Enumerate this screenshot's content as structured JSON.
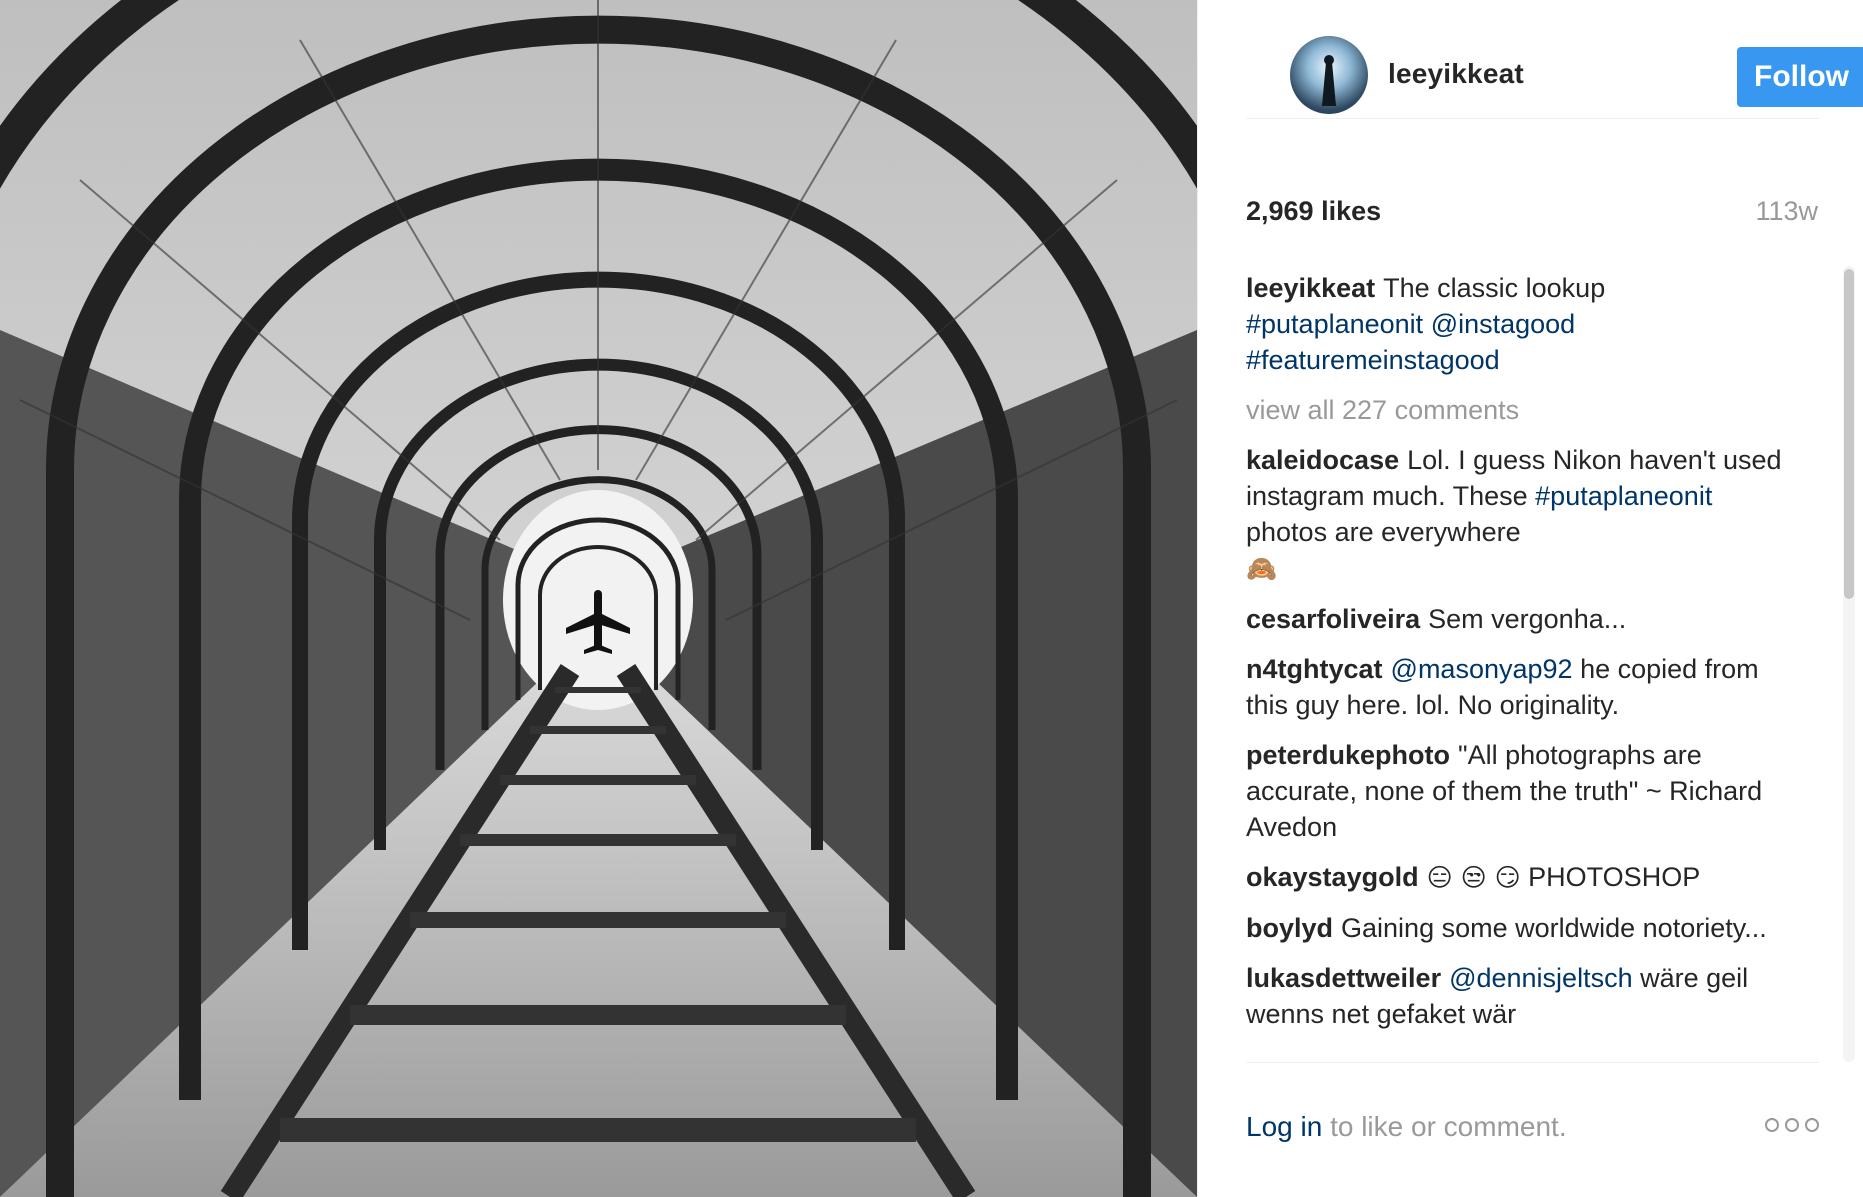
{
  "post": {
    "image_alt": "Black and white photo of a caged ladder tunnel with an airplane at the end",
    "username": "leeyikkeat",
    "follow_label": "Follow",
    "likes": "2,969 likes",
    "age": "113w",
    "caption": {
      "user": "leeyikkeat",
      "text": "The classic lookup",
      "tag1": "#putaplaneonit",
      "tag2": "@instagood",
      "tag3": "#featuremeinstagood"
    },
    "view_all": "view all 227 comments",
    "comments": [
      {
        "user": "kaleidocase",
        "text_a": "Lol. I guess Nikon haven't used instagram much. These",
        "tag": "#putaplaneonit",
        "text_b": "photos are everywhere",
        "emoji": "🙈"
      },
      {
        "user": "cesarfoliveira",
        "text": "Sem vergonha..."
      },
      {
        "user": "n4tghtycat",
        "tag": "@masonyap92",
        "text": "he copied from this guy here. lol. No originality."
      },
      {
        "user": "peterdukephoto",
        "text": "\"All photographs are accurate, none of them the truth\" ~ Richard Avedon"
      },
      {
        "user": "okaystaygold",
        "emoji": "😑 😒 😏",
        "text": "PHOTOSHOP"
      },
      {
        "user": "boylyd",
        "text": "Gaining some worldwide notoriety..."
      },
      {
        "user": "lukasdettweiler",
        "tag": "@dennisjeltsch",
        "text": "wäre geil wenns net gefaket wär"
      }
    ],
    "footer": {
      "login_link": "Log in",
      "login_rest": "to like or comment."
    },
    "icons": {
      "more": "more-options-icon"
    },
    "colors": {
      "follow_button": "#3897f0",
      "link": "#003569",
      "muted": "#999999",
      "text": "#262626"
    }
  }
}
